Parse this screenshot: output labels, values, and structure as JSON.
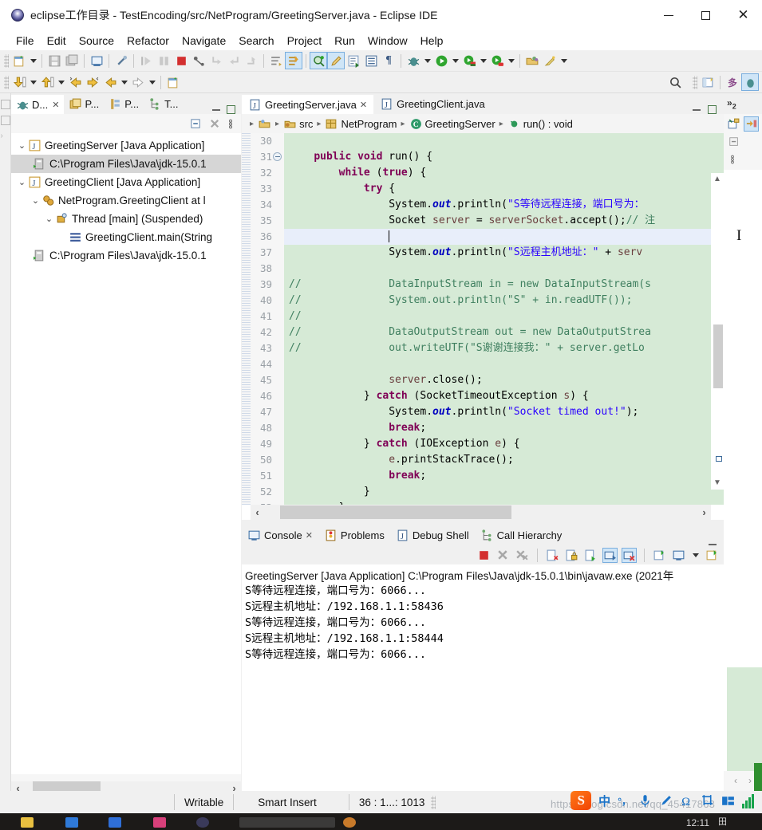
{
  "window": {
    "title": "eclipse工作目录 - TestEncoding/src/NetProgram/GreetingServer.java - Eclipse IDE",
    "icon": "eclipse-icon",
    "buttons": {
      "minimize": "minimize-icon",
      "maximize": "maximize-icon",
      "close": "✕"
    }
  },
  "menu": {
    "items": [
      "File",
      "Edit",
      "Source",
      "Refactor",
      "Navigate",
      "Search",
      "Project",
      "Run",
      "Window",
      "Help"
    ]
  },
  "toolbar": {
    "row1": [
      "new-wizard-icon",
      "dropdown",
      "save-icon",
      "save-all-icon",
      "print-icon",
      "link-break-icon",
      "step-over-icon",
      "pause-icon",
      "terminate-icon",
      "skip-breakpoints-icon",
      "step-into-icon",
      "step-return-icon",
      "drop-to-frame-icon",
      "open-task-icon",
      "toggle-mark-occurrences-icon",
      "search-icon",
      "pencil-icon",
      "open-type-icon",
      "open-element-icon",
      "pilcrow-icon",
      "debug-icon",
      "dropdown",
      "run-icon",
      "dropdown",
      "run-config-icon",
      "dropdown",
      "coverage-icon",
      "dropdown",
      "open-perspective-icon",
      "wand-icon",
      "dropdown"
    ],
    "row2": [
      "download-icon",
      "dropdown",
      "upload-icon",
      "dropdown",
      "back-annotated-icon",
      "forward-annotated-icon",
      "back-icon",
      "dropdown",
      "forward-icon",
      "dropdown",
      "new-window-icon"
    ],
    "right": [
      "search-icon",
      "open-perspective-icon",
      "java-perspective-icon",
      "debug-perspective-icon"
    ]
  },
  "left_panel": {
    "tabs": [
      {
        "label": "D...",
        "icon": "debug-icon",
        "active": true,
        "closable": true
      },
      {
        "label": "P...",
        "icon": "package-explorer-icon",
        "active": false
      },
      {
        "label": "P...",
        "icon": "project-explorer-icon",
        "active": false
      },
      {
        "label": "T...",
        "icon": "type-hierarchy-icon",
        "active": false
      }
    ],
    "minimize": "minimize-view-icon",
    "maximize": "maximize-view-icon",
    "view_toolbar": [
      "collapse-all-icon",
      "remove-all-terminated-icon",
      "view-menu-icon"
    ],
    "tree": [
      {
        "indent": 0,
        "twisty": "expanded",
        "icon": "launch-config-icon",
        "label": "GreetingServer [Java Application]",
        "selected": false
      },
      {
        "indent": 1,
        "twisty": "none",
        "icon": "java-process-icon",
        "label": "C:\\Program Files\\Java\\jdk-15.0.1",
        "selected": true
      },
      {
        "indent": 0,
        "twisty": "expanded",
        "icon": "launch-config-icon",
        "label": "GreetingClient [Java Application]",
        "selected": false
      },
      {
        "indent": 1,
        "twisty": "expanded",
        "icon": "debug-target-icon",
        "label": "NetProgram.GreetingClient at l",
        "selected": false
      },
      {
        "indent": 2,
        "twisty": "expanded",
        "icon": "thread-icon",
        "label": "Thread [main] (Suspended)",
        "selected": false
      },
      {
        "indent": 3,
        "twisty": "none",
        "icon": "stack-frame-icon",
        "label": "GreetingClient.main(String",
        "selected": false
      },
      {
        "indent": 1,
        "twisty": "none",
        "icon": "java-process-icon",
        "label": "C:\\Program Files\\Java\\jdk-15.0.1",
        "selected": false
      }
    ]
  },
  "editor": {
    "tabs": [
      {
        "label": "GreetingServer.java",
        "icon": "java-file-icon",
        "active": true,
        "closable": true
      },
      {
        "label": "GreetingClient.java",
        "icon": "java-file-icon",
        "active": false,
        "closable": false
      }
    ],
    "minimize": "minimize-view-icon",
    "maximize": "maximize-view-icon",
    "breadcrumb": [
      {
        "icon": "project-icon",
        "label": ""
      },
      {
        "icon": "source-folder-icon",
        "label": "src"
      },
      {
        "icon": "package-icon",
        "label": "NetProgram"
      },
      {
        "icon": "class-icon",
        "label": "GreetingServer"
      },
      {
        "icon": "method-icon",
        "label": "run() : void"
      }
    ],
    "first_line_number": 30,
    "lines": [
      {
        "n": 30,
        "text": "",
        "current": false,
        "fold": false
      },
      {
        "n": 31,
        "text": "    public void run() {",
        "current": false,
        "fold": true
      },
      {
        "n": 32,
        "text": "        while (true) {",
        "current": false,
        "fold": false
      },
      {
        "n": 33,
        "text": "            try {",
        "current": false,
        "fold": false
      },
      {
        "n": 34,
        "text": "                System.out.println(\"S等待远程连接，端口号为：",
        "current": false,
        "fold": false
      },
      {
        "n": 35,
        "text": "                Socket server = serverSocket.accept();// 注",
        "current": false,
        "fold": false
      },
      {
        "n": 36,
        "text": "",
        "current": true,
        "fold": false
      },
      {
        "n": 37,
        "text": "                System.out.println(\"S远程主机地址：\" + serv",
        "current": false,
        "fold": false
      },
      {
        "n": 38,
        "text": "",
        "current": false,
        "fold": false
      },
      {
        "n": 39,
        "text": "//              DataInputStream in = new DataInputStream(s",
        "current": false,
        "fold": false
      },
      {
        "n": 40,
        "text": "//              System.out.println(\"S\" + in.readUTF());",
        "current": false,
        "fold": false
      },
      {
        "n": 41,
        "text": "//",
        "current": false,
        "fold": false
      },
      {
        "n": 42,
        "text": "//              DataOutputStream out = new DataOutputStrea",
        "current": false,
        "fold": false
      },
      {
        "n": 43,
        "text": "//              out.writeUTF(\"S谢谢连接我：\" + server.getLo",
        "current": false,
        "fold": false
      },
      {
        "n": 44,
        "text": "",
        "current": false,
        "fold": false
      },
      {
        "n": 45,
        "text": "                server.close();",
        "current": false,
        "fold": false
      },
      {
        "n": 46,
        "text": "            } catch (SocketTimeoutException s) {",
        "current": false,
        "fold": false
      },
      {
        "n": 47,
        "text": "                System.out.println(\"Socket timed out!\");",
        "current": false,
        "fold": false
      },
      {
        "n": 48,
        "text": "                break;",
        "current": false,
        "fold": false
      },
      {
        "n": 49,
        "text": "            } catch (IOException e) {",
        "current": false,
        "fold": false
      },
      {
        "n": 50,
        "text": "                e.printStackTrace();",
        "current": false,
        "fold": false
      },
      {
        "n": 51,
        "text": "                break;",
        "current": false,
        "fold": false
      },
      {
        "n": 52,
        "text": "            }",
        "current": false,
        "fold": false
      },
      {
        "n": 53,
        "text": "        }",
        "current": false,
        "fold": false
      }
    ]
  },
  "console": {
    "tabs": [
      {
        "label": "Console",
        "icon": "console-icon",
        "active": true,
        "closable": true
      },
      {
        "label": "Problems",
        "icon": "problems-icon",
        "active": false
      },
      {
        "label": "Debug Shell",
        "icon": "debug-shell-icon",
        "active": false
      },
      {
        "label": "Call Hierarchy",
        "icon": "call-hierarchy-icon",
        "active": false
      }
    ],
    "minimize": "minimize-view-icon",
    "toolbar": [
      "terminate-icon",
      "remove-launch-icon",
      "remove-all-launches-icon",
      "clear-console-icon",
      "scroll-lock-icon",
      "word-wrap-icon",
      "show-console-on-output-icon",
      "show-console-on-error-icon",
      "pin-console-icon",
      "display-selected-console-icon",
      "dropdown",
      "open-console-icon"
    ],
    "header": "GreetingServer [Java Application] C:\\Program Files\\Java\\jdk-15.0.1\\bin\\javaw.exe  (2021年",
    "output": [
      "S等待远程连接，端口号为：6066...",
      "S远程主机地址：/192.168.1.1:58436",
      "S等待远程连接，端口号为：6066...",
      "S远程主机地址：/192.168.1.1:58444",
      "S等待远程连接，端口号为：6066..."
    ]
  },
  "right_panel": {
    "tab_overflow": "view-overflow-icon",
    "toolbar": [
      "show-logical-structure-icon",
      "show-variable-details-icon"
    ],
    "toolbar2": [
      "collapse-all-icon"
    ],
    "toolbar3": [
      "view-menu-icon"
    ],
    "cursor": "text-cursor-icon",
    "nav": {
      "prev": "‹",
      "next": "›"
    }
  },
  "statusbar": {
    "writable": "Writable",
    "insert_mode": "Smart Insert",
    "position": "36 : 1...: 1013"
  },
  "ime": {
    "logo": "S",
    "mode": "中",
    "punctuation": "°，",
    "items": [
      "microphone-icon",
      "pen-icon",
      "omega-icon",
      "screenshot-icon",
      "keyboard-icon"
    ]
  },
  "watermark": "https://blog.csdn.net/qq_45417863",
  "taskbar": {
    "clock": "12:11"
  },
  "colors": {
    "code_highlight_bg": "#d6ead6",
    "current_line_bg": "#e8eefa",
    "keyword": "#7f0055",
    "string": "#2a00ff",
    "comment": "#3f7f5f",
    "field": "#0000c0",
    "local_var": "#6a3e3e",
    "toolbar_active": "#cfe5f7",
    "tree_selected": "#d6d6d6"
  }
}
